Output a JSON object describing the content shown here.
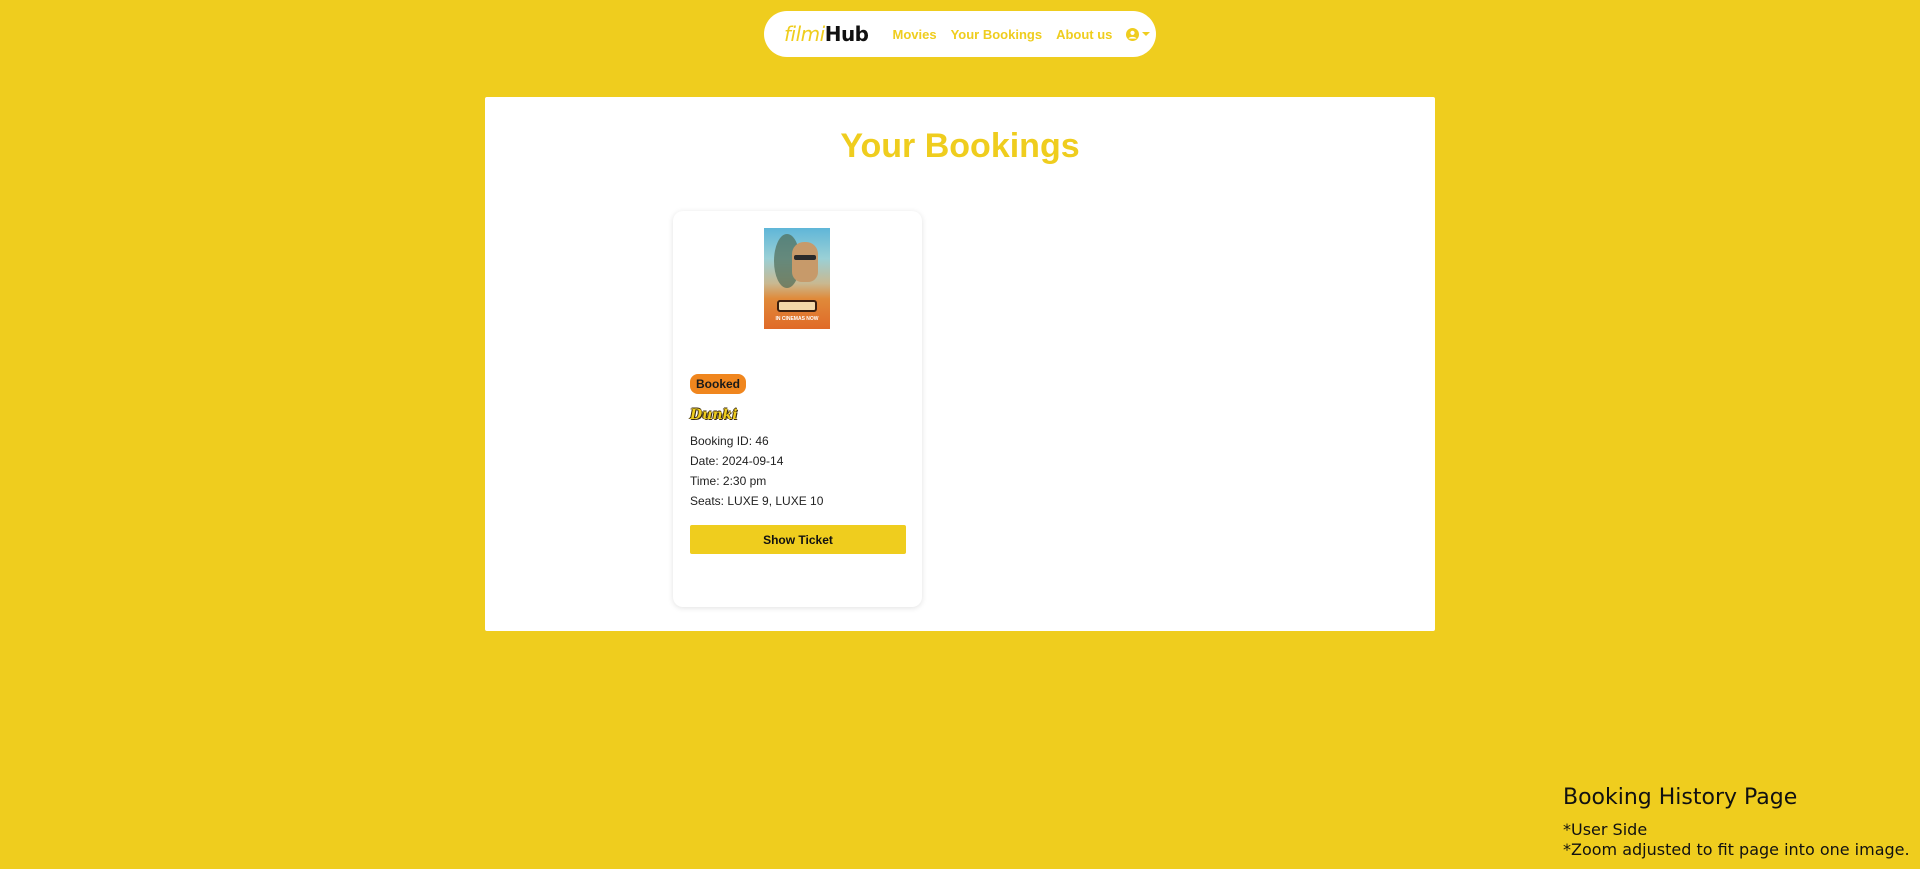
{
  "nav": {
    "brand_part1": "filmi",
    "brand_part2": "Hub",
    "links": [
      "Movies",
      "Your Bookings",
      "About us"
    ],
    "account_icon": "user-circle-icon"
  },
  "page": {
    "title": "Your Bookings"
  },
  "bookings": [
    {
      "status": "Booked",
      "movie_title": "Dunki",
      "poster_caption": "IN CINEMAS NOW",
      "booking_id": "Booking ID: 46",
      "date": "Date: 2024-09-14",
      "time": "Time: 2:30 pm",
      "seats": "Seats: LUXE 9, LUXE 10",
      "button_label": "Show Ticket"
    }
  ],
  "annotation": {
    "title": "Booking History Page",
    "line1": "*User Side",
    "line2": "*Zoom adjusted to fit page into one image."
  },
  "colors": {
    "background": "#EFCD1E",
    "accent": "#EFCD1E",
    "badge": "#F0861E"
  }
}
